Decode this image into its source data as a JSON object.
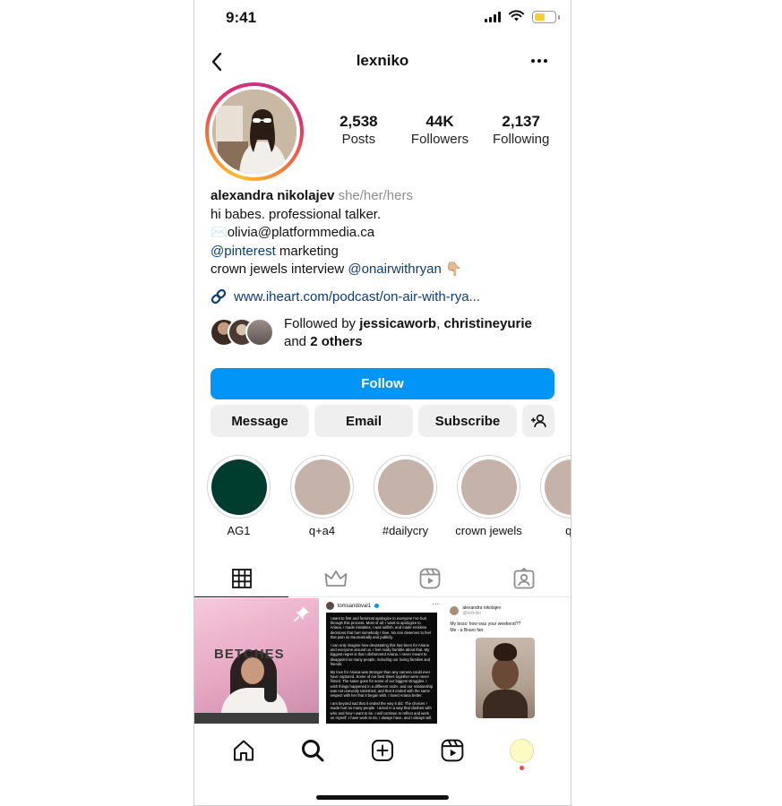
{
  "status_bar": {
    "time": "9:41"
  },
  "header": {
    "username": "lexniko"
  },
  "stats": [
    {
      "count": "2,538",
      "label": "Posts"
    },
    {
      "count": "44K",
      "label": "Followers"
    },
    {
      "count": "2,137",
      "label": "Following"
    }
  ],
  "bio": {
    "name": "alexandra nikolajev",
    "pronouns": "she/her/hers",
    "line1": "hi babes. professional talker.",
    "email_emoji": "✉️",
    "email": "olivia@platformmedia.ca",
    "mention1": "@pinterest",
    "line3_rest": " marketing",
    "line4_prefix": "crown jewels interview ",
    "mention2": "@onairwithryan",
    "line4_emoji": "👇🏼",
    "link": "www.iheart.com/podcast/on-air-with-rya..."
  },
  "followed_by": {
    "prefix": "Followed by ",
    "user1": "jessicaworb",
    "sep": ", ",
    "user2": "christineyurie",
    "and": "and ",
    "others": "2 others"
  },
  "buttons": {
    "follow": "Follow",
    "message": "Message",
    "email": "Email",
    "subscribe": "Subscribe"
  },
  "highlights": [
    {
      "label": "AG1",
      "color": "#003d2e"
    },
    {
      "label": "q+a4",
      "color": "#c5b3a9"
    },
    {
      "label": "#dailycry",
      "color": "#c5b3a9"
    },
    {
      "label": "crown jewels",
      "color": "#c5b3a9"
    },
    {
      "label": "q+",
      "color": "#c5b3a9"
    }
  ],
  "tabs": [
    "grid-icon",
    "crown-icon",
    "reels-icon",
    "tagged-icon"
  ],
  "posts": {
    "post1_logo": "BETCHES",
    "post2_user": "tomsandoval1",
    "post2_p1": "I want to first and foremost apologize to everyone I've hurt through this process. Most of all, I want to apologize to Ariana. I made mistakes, I was selfish, and made reckless decisions that hurt somebody I love. No one deserves to feel that pain so traumatically and publicly.",
    "post2_p2": "I can only imagine how devastating this has been for Ariana and everyone around us. I feel really horrible about that. My biggest regret is that I dishonored Ariana. I never meant to disappoint so many people, including our loving families and friends.",
    "post2_p3": "My love for Ariana was stronger than any camera could ever have captured. Some of our best times together were never filmed. The same goes for some of our biggest struggles. I wish things happened in a different order, and our relationship was not unevenly tarnished, and that it ended with the same respect with her that it began with. I loved Ariana better.",
    "post2_p4": "I am beyond sad that it ended the way it did. The choices I made hurt so many people. I acted in a way that clashes with who and how I want to be. I will continue to reflect and work on myself. I have work to do. I always have, and I always will.",
    "post3_name": "alexandra nikolajev",
    "post3_handle": "@lexniko",
    "post3_line1": "My boss: how was your weekend??",
    "post3_line2": "Me - a Bravo fan:"
  },
  "colors": {
    "accent": "#0095f6",
    "link": "#0d3d75",
    "button_bg": "#efefef",
    "notification": "#ed4956"
  }
}
